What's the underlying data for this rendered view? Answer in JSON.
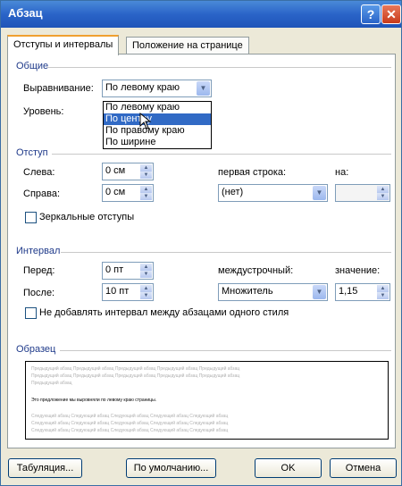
{
  "window": {
    "title": "Абзац",
    "help_glyph": "?",
    "close_glyph": "✕"
  },
  "tabs": [
    {
      "label": "Отступы и интервалы"
    },
    {
      "label": "Положение на странице"
    }
  ],
  "general": {
    "section": "Общие",
    "alignment_label": "Выравнивание:",
    "alignment_value": "По левому краю",
    "level_label": "Уровень:",
    "options": [
      "По левому краю",
      "По центру",
      "По правому краю",
      "По ширине"
    ],
    "highlighted": "По центру"
  },
  "indent": {
    "section": "Отступ",
    "left_label": "Слева:",
    "left_value": "0 см",
    "right_label": "Справа:",
    "right_value": "0 см",
    "first_line_label": "первая строка:",
    "first_line_value": "(нет)",
    "on_label": "на:",
    "on_value": "",
    "mirror_label": "Зеркальные отступы"
  },
  "spacing": {
    "section": "Интервал",
    "before_label": "Перед:",
    "before_value": "0 пт",
    "after_label": "После:",
    "after_value": "10 пт",
    "line_label": "междустрочный:",
    "line_value": "Множитель",
    "value_label": "значение:",
    "value_value": "1,15",
    "no_space_label": "Не добавлять интервал между абзацами одного стиля"
  },
  "preview": {
    "section": "Образец",
    "prev_lines": [
      "Предыдущий абзац Предыдущий абзац Предыдущий абзац Предыдущий абзац Предыдущий абзац",
      "Предыдущий абзац Предыдущий абзац Предыдущий абзац Предыдущий абзац Предыдущий абзац",
      "Предыдущий абзац"
    ],
    "sample_line": "Это предложение мы выровняли по левому краю страницы.",
    "next_lines": [
      "Следующий абзац Следующий абзац Следующий абзац Следующий абзац Следующий абзац",
      "Следующий абзац Следующий абзац Следующий абзац Следующий абзац Следующий абзац",
      "Следующий абзац Следующий абзац Следующий абзац Следующий абзац Следующий абзац"
    ]
  },
  "buttons": {
    "tabs": "Табуляция...",
    "default": "По умолчанию...",
    "ok": "OK",
    "cancel": "Отмена"
  }
}
